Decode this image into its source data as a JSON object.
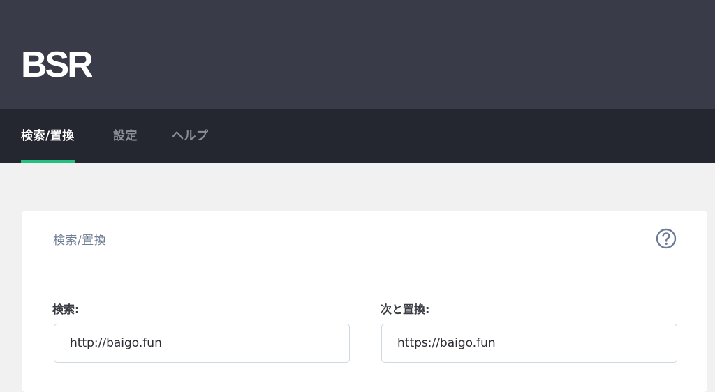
{
  "app": {
    "logo_text": "BSR"
  },
  "nav": {
    "tabs": [
      {
        "label": "検索/置換",
        "active": true
      },
      {
        "label": "設定",
        "active": false
      },
      {
        "label": "ヘルプ",
        "active": false
      }
    ]
  },
  "panel": {
    "title": "検索/置換",
    "help_icon": "question-circle-icon",
    "search": {
      "label": "検索:",
      "value": "http://baigo.fun"
    },
    "replace": {
      "label": "次と置換:",
      "value": "https://baigo.fun"
    }
  },
  "colors": {
    "header_bg": "#393b48",
    "nav_bg": "#252730",
    "accent": "#23c17f",
    "page_bg": "#f1f1f1"
  }
}
